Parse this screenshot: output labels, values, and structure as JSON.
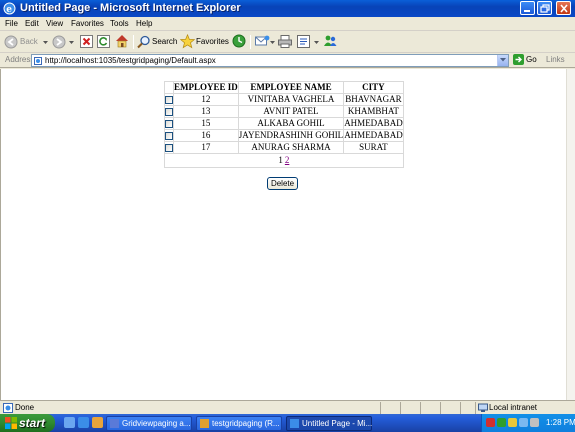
{
  "window": {
    "title": "Untitled Page - Microsoft Internet Explorer"
  },
  "menu": {
    "items": [
      {
        "label": "File"
      },
      {
        "label": "Edit"
      },
      {
        "label": "View"
      },
      {
        "label": "Favorites"
      },
      {
        "label": "Tools"
      },
      {
        "label": "Help"
      }
    ]
  },
  "toolbar": {
    "back_label": "Back",
    "search_label": "Search",
    "favorites_label": "Favorites"
  },
  "address": {
    "label": "Address",
    "url": "http://localhost:1035/testgridpaging/Default.aspx",
    "go_label": "Go",
    "links_label": "Links"
  },
  "grid": {
    "headers": [
      "EMPLOYEE ID",
      "EMPLOYEE NAME",
      "CITY"
    ],
    "rows": [
      {
        "id": "12",
        "name": "VINITABA VAGHELA",
        "city": "BHAVNAGAR"
      },
      {
        "id": "13",
        "name": "AVNIT PATEL",
        "city": "KHAMBHAT"
      },
      {
        "id": "15",
        "name": "ALKABA GOHIL",
        "city": "AHMEDABAD"
      },
      {
        "id": "16",
        "name": "JAYENDRASHINH GOHIL",
        "city": "AHMEDABAD"
      },
      {
        "id": "17",
        "name": "ANURAG SHARMA",
        "city": "SURAT"
      }
    ],
    "pager": {
      "current": "1",
      "next": "2"
    }
  },
  "delete_label": "Delete",
  "status": {
    "text": "Done",
    "zone": "Local intranet"
  },
  "taskbar": {
    "start_label": "start",
    "tasks": [
      {
        "label": "Gridviewpaging a..."
      },
      {
        "label": "testgridpaging (R..."
      },
      {
        "label": "Untitled Page - Mi..."
      }
    ],
    "clock": "1:28 PM"
  },
  "colors": {
    "title_bar": "#0a48c6",
    "link_visited": "#800080",
    "taskbar": "#245edb",
    "start_button": "#2f8a2f"
  }
}
